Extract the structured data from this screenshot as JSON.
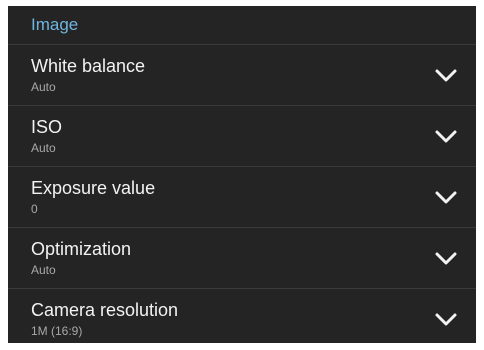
{
  "section": {
    "title": "Image"
  },
  "settings": [
    {
      "label": "White balance",
      "value": "Auto",
      "icon": "chevron-down-icon"
    },
    {
      "label": "ISO",
      "value": "Auto",
      "icon": "chevron-down-icon"
    },
    {
      "label": "Exposure value",
      "value": "0",
      "icon": "chevron-down-icon"
    },
    {
      "label": "Optimization",
      "value": "Auto",
      "icon": "chevron-down-icon"
    },
    {
      "label": "Camera resolution",
      "value": "1M (16:9)",
      "icon": "chevron-down-icon"
    }
  ],
  "colors": {
    "background": "#242424",
    "header_text": "#6fb5df",
    "title_text": "#f2f2f2",
    "value_text": "#a8a8a8",
    "divider": "#3a3a3a"
  }
}
